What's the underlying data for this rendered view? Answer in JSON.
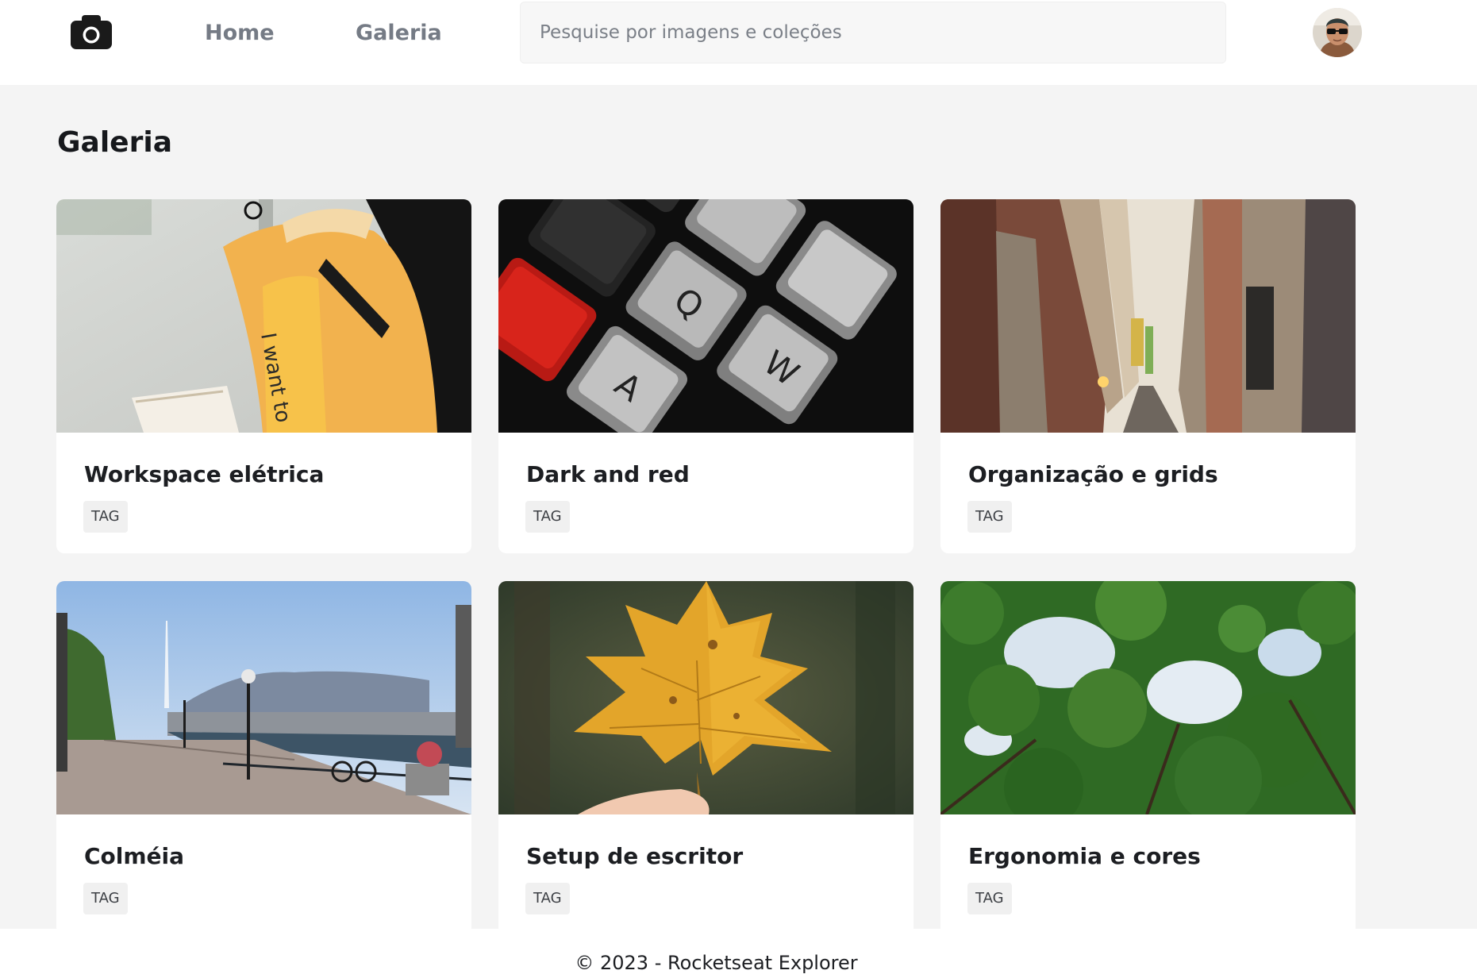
{
  "header": {
    "logo_icon": "camera-icon",
    "nav": [
      {
        "label": "Home"
      },
      {
        "label": "Galeria"
      }
    ],
    "search": {
      "placeholder": "Pesquise por imagens e coleções",
      "value": ""
    },
    "avatar_icon": "user-avatar-icon"
  },
  "main": {
    "title": "Galeria",
    "cards": [
      {
        "title": "Workspace elétrica",
        "tag": "TAG",
        "image_icon": "photo-woman-yellow-jacket"
      },
      {
        "title": "Dark and red",
        "tag": "TAG",
        "image_icon": "photo-keyboard-keys"
      },
      {
        "title": "Organização e grids",
        "tag": "TAG",
        "image_icon": "photo-narrow-alley"
      },
      {
        "title": "Colméia",
        "tag": "TAG",
        "image_icon": "photo-lake-promenade"
      },
      {
        "title": "Setup de escritor",
        "tag": "TAG",
        "image_icon": "photo-autumn-leaf"
      },
      {
        "title": "Ergonomia e cores",
        "tag": "TAG",
        "image_icon": "photo-green-trees"
      }
    ]
  },
  "footer": {
    "text": "© 2023 - Rocketseat Explorer"
  },
  "colors": {
    "page_background": "#f4f4f4",
    "surface": "#ffffff",
    "nav_text": "#757b85",
    "heading_text": "#16181c",
    "tag_background": "#f0f0f0"
  }
}
